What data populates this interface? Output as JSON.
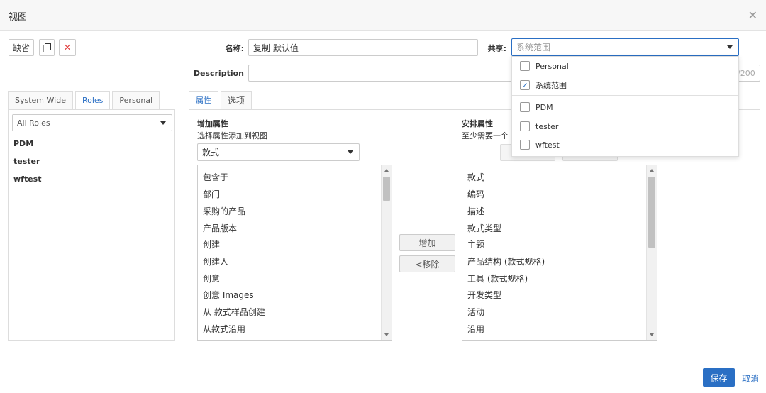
{
  "dialog": {
    "title": "视图"
  },
  "toolbar": {
    "default_label": "缺省",
    "delete_label": "×"
  },
  "form": {
    "name_label": "名称:",
    "name_value": "复制 默认值",
    "description_label": "Description",
    "description_count": "/200",
    "share_label": "共享:",
    "share_placeholder": "系统范围"
  },
  "share_dropdown": {
    "options": [
      {
        "label": "Personal",
        "checked": false
      },
      {
        "label": "系统范围",
        "checked": true
      },
      {
        "label": "PDM",
        "checked": false
      },
      {
        "label": "tester",
        "checked": false
      },
      {
        "label": "wftest",
        "checked": false
      }
    ],
    "check_mark": "✓"
  },
  "left_tabs": [
    {
      "label": "System Wide",
      "active": false
    },
    {
      "label": "Roles",
      "active": true
    },
    {
      "label": "Personal",
      "active": false
    }
  ],
  "roles": {
    "select_value": "All Roles",
    "items": [
      "PDM",
      "tester",
      "wftest"
    ]
  },
  "right_tabs": [
    {
      "label": "属性",
      "active": true
    },
    {
      "label": "选项",
      "active": false
    }
  ],
  "add_attributes": {
    "heading": "增加属性",
    "subheading": "选择属性添加到视图",
    "select_value": "款式",
    "items": [
      "包含于",
      "部门",
      "采购的产品",
      "产品版本",
      "创建",
      "创建人",
      "创意",
      "创意 Images",
      "从 款式样品创建",
      "从款式沿用"
    ]
  },
  "arrange_attributes": {
    "heading": "安排属性",
    "subheading": "至少需要一个",
    "items": [
      "款式",
      "编码",
      "描述",
      "款式类型",
      "主题",
      "产品结构 (款式规格)",
      "工具 (款式规格)",
      "开发类型",
      "活动",
      "沿用"
    ]
  },
  "actions": {
    "add_label": "增加",
    "remove_label": "<移除"
  },
  "footer": {
    "save_label": "保存",
    "cancel_label": "取消"
  },
  "colors": {
    "accent": "#2a6fc4",
    "delete": "#e23a3a"
  }
}
